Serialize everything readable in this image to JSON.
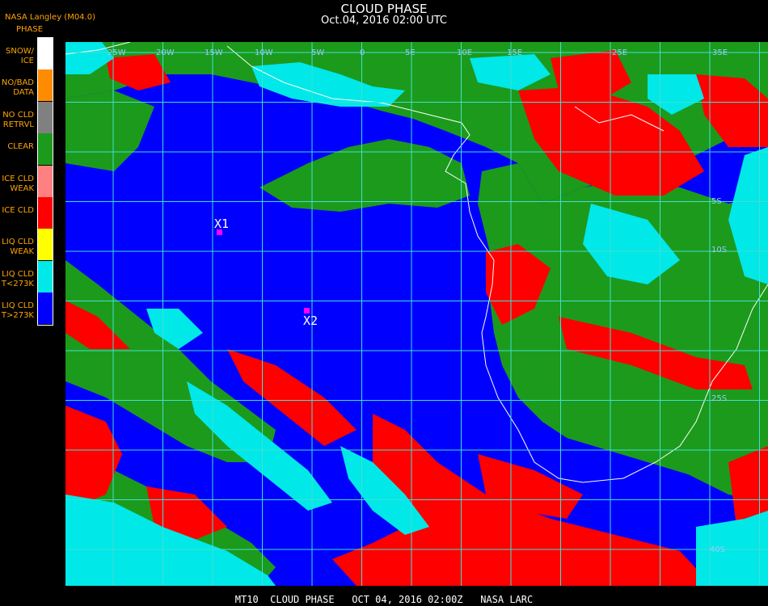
{
  "header": {
    "title": "CLOUD PHASE",
    "datetime": "Oct.04, 2016 02:00 UTC",
    "producer": "NASA Langley (M04.0)"
  },
  "legend": {
    "title": "PHASE",
    "items": [
      {
        "label1": "SNOW/",
        "label2": "ICE",
        "color": "#ffffff"
      },
      {
        "label1": "NO/BAD",
        "label2": "DATA",
        "color": "#ff8c00"
      },
      {
        "label1": "NO CLD",
        "label2": "RETRVL",
        "color": "#808080"
      },
      {
        "label1": "CLEAR",
        "label2": "",
        "color": "#1c9a1c"
      },
      {
        "label1": "ICE CLD",
        "label2": "WEAK",
        "color": "#ff8080"
      },
      {
        "label1": "ICE CLD",
        "label2": "",
        "color": "#ff0000"
      },
      {
        "label1": "LIQ CLD",
        "label2": "WEAK",
        "color": "#ffff00"
      },
      {
        "label1": "LIQ CLD",
        "label2": "T<273K",
        "color": "#00e8e8"
      },
      {
        "label1": "LIQ CLD",
        "label2": "T>273K",
        "color": "#0000ff"
      }
    ]
  },
  "map": {
    "grid_labels": {
      "lon_25w": "25W",
      "lon_20w": "20W",
      "lon_15w": "15W",
      "lon_10w": "10W",
      "lon_5w": "5W",
      "lon_0": "0",
      "lon_5e": "5E",
      "lon_10e": "10E",
      "lon_15e": "15E",
      "lon_25e": "25E",
      "lon_35e": "35E",
      "lat_5s": "5S",
      "lat_10s": "10S",
      "lat_25s": "25S",
      "lat_40s": "40S"
    },
    "markers": {
      "x1": "X1",
      "x2": "X2"
    }
  },
  "footer": {
    "text": "MT10  CLOUD PHASE   OCT 04, 2016 02:00Z   NASA LARC"
  }
}
